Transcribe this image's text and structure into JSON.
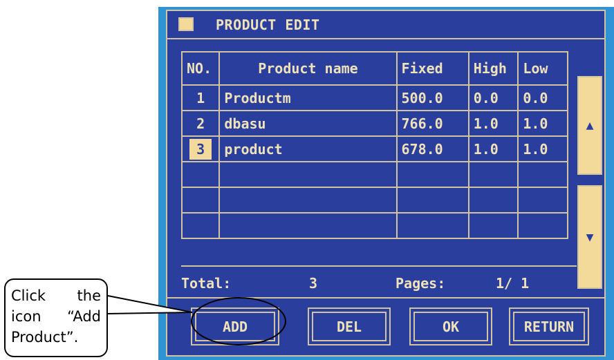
{
  "window": {
    "title": "PRODUCT EDIT"
  },
  "table": {
    "headers": {
      "no": "NO.",
      "name": "Product name",
      "fixed": "Fixed",
      "high": "High",
      "low": "Low"
    },
    "rows": [
      {
        "no": "1",
        "name": "Productm",
        "fixed": "500.0",
        "high": "0.0",
        "low": "0.0",
        "selected": false
      },
      {
        "no": "2",
        "name": "dbasu",
        "fixed": "766.0",
        "high": "1.0",
        "low": "1.0",
        "selected": false
      },
      {
        "no": "3",
        "name": "product",
        "fixed": "678.0",
        "high": "1.0",
        "low": "1.0",
        "selected": true
      }
    ],
    "empty_rows": 3
  },
  "footer": {
    "total_label": "Total:",
    "total_value": "3",
    "pages_label": "Pages:",
    "pages_value": "1/ 1"
  },
  "scroll": {
    "up_icon": "arrow-up-icon",
    "down_icon": "arrow-down-icon"
  },
  "buttons": {
    "add": "ADD",
    "del": "DEL",
    "ok": "OK",
    "return": "RETURN"
  },
  "callout": {
    "text": "Click the icon “Add Product”."
  },
  "colors": {
    "screen_bg": "#2f93d4",
    "panel_bg": "#2a3e9e",
    "text": "#f0e2b8",
    "accent": "#f3d99a"
  }
}
